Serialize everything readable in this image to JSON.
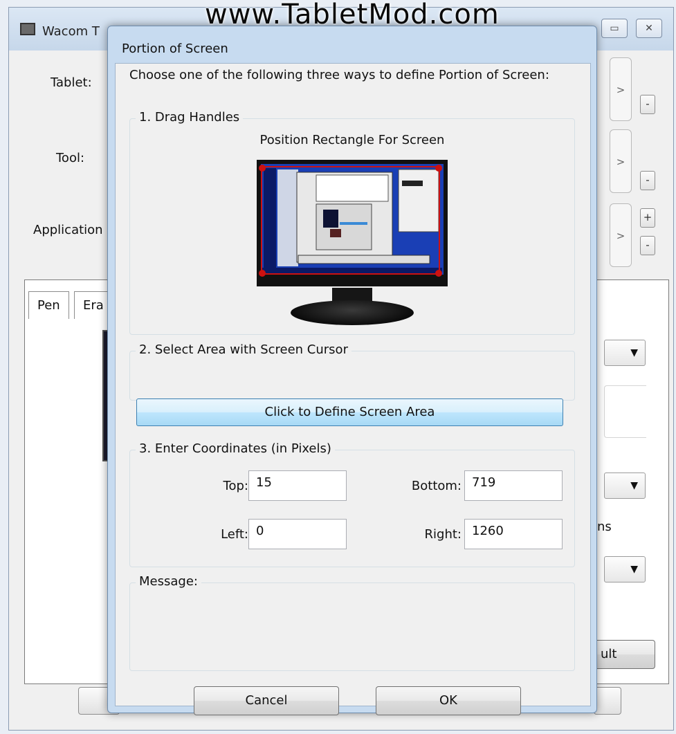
{
  "watermark": "www.TabletMod.com",
  "background_window": {
    "title": "Wacom T",
    "labels": {
      "tablet": "Tablet:",
      "tool": "Tool:",
      "application": "Application"
    },
    "scroll_arrow": ">",
    "minus": "-",
    "plus": "+",
    "tabs": {
      "pen": "Pen",
      "eraser": "Era"
    },
    "partial_text": {
      "ns": "ns",
      "default_btn": "ult"
    },
    "window_buttons": {
      "restore": "▭",
      "close": "✕"
    }
  },
  "dialog": {
    "title": "Portion of Screen",
    "instructions": "Choose one of the following three ways to define Portion of Screen:",
    "section1": {
      "label": "1. Drag Handles",
      "caption": "Position Rectangle For Screen"
    },
    "section2": {
      "label": "2. Select Area with Screen Cursor",
      "button": "Click to Define Screen Area"
    },
    "section3": {
      "label": "3. Enter Coordinates (in Pixels)",
      "top_label": "Top:",
      "top_value": "15",
      "bottom_label": "Bottom:",
      "bottom_value": "719",
      "left_label": "Left:",
      "left_value": "0",
      "right_label": "Right:",
      "right_value": "1260"
    },
    "message": {
      "label": "Message:",
      "text": ""
    },
    "buttons": {
      "cancel": "Cancel",
      "ok": "OK"
    }
  },
  "colors": {
    "dialog_frame": "#c7dbf0",
    "define_button": "#bee6fd",
    "handle_red": "#cc1111"
  }
}
